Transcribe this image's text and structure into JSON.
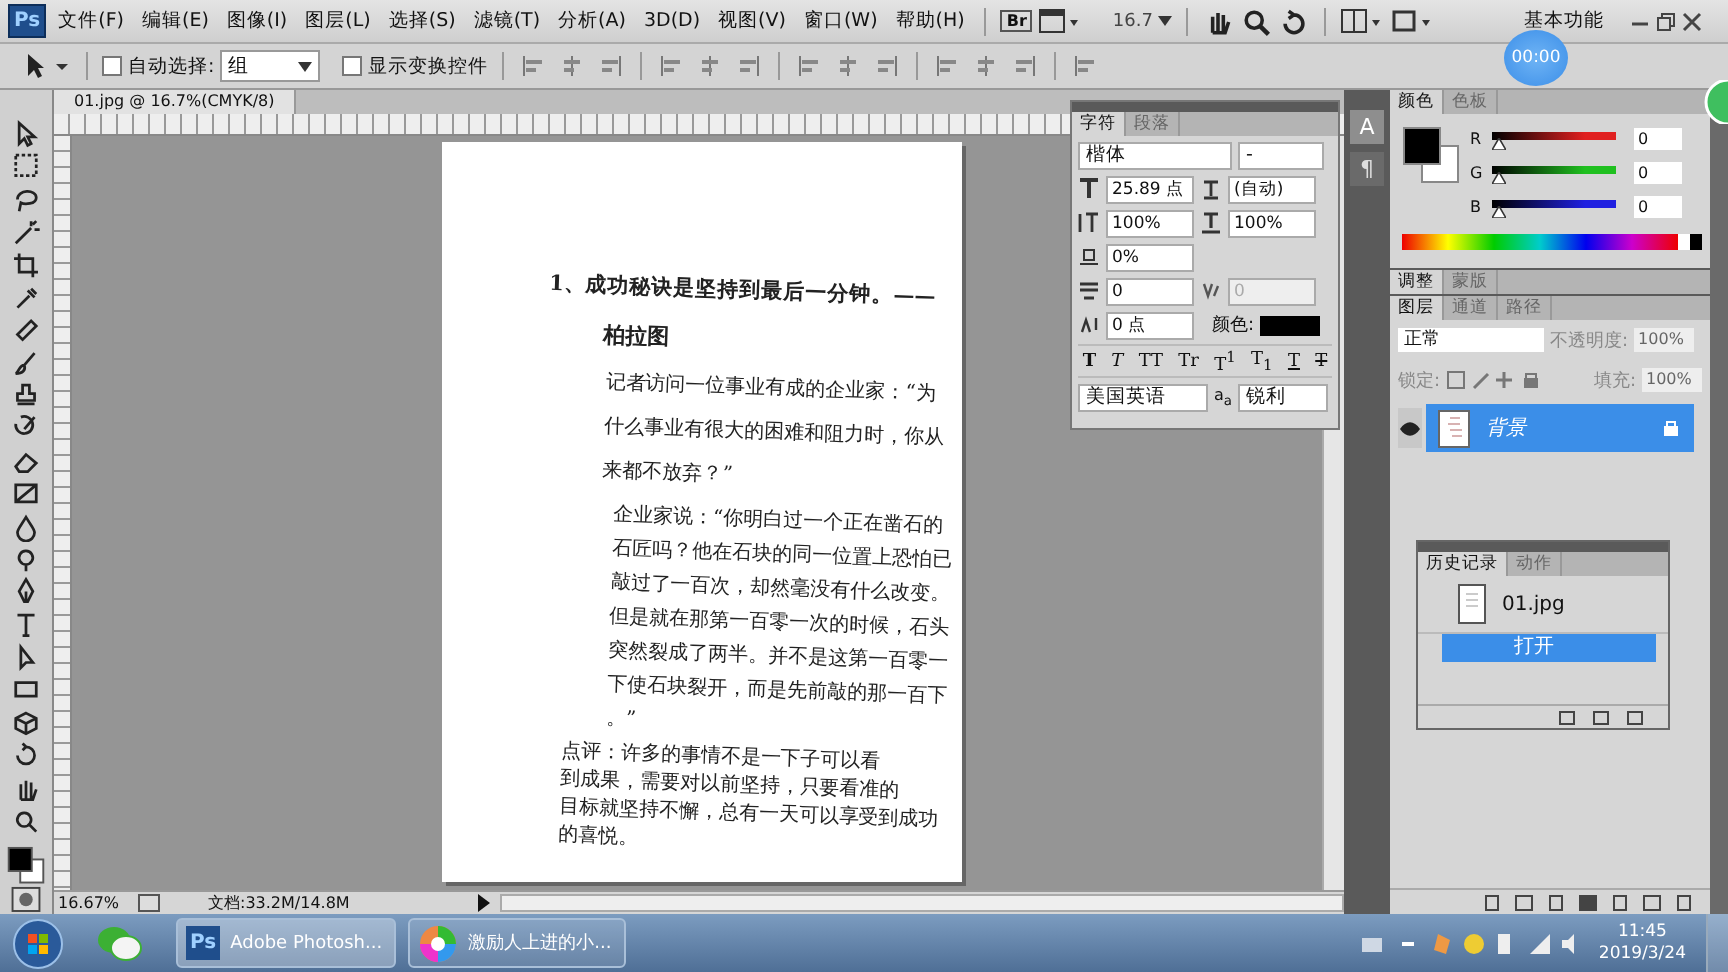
{
  "menubar": {
    "logo": "Ps",
    "items": [
      "文件(F)",
      "编辑(E)",
      "图像(I)",
      "图层(L)",
      "选择(S)",
      "滤镜(T)",
      "分析(A)",
      "3D(D)",
      "视图(V)",
      "窗口(W)",
      "帮助(H)"
    ],
    "bridge": "Br",
    "zoom": "16.7",
    "workspace": "基本功能"
  },
  "timer_badge": "00:00",
  "options_bar": {
    "auto_select": {
      "label": "自动选择:",
      "checked": false,
      "value": "组"
    },
    "show_transform": {
      "label": "显示变换控件",
      "checked": false
    }
  },
  "document": {
    "tab": "01.jpg @ 16.7%(CMYK/8)",
    "lines": [
      {
        "text": "1、成功秘诀是坚持到最后一分钟。——",
        "kind": "heading"
      },
      {
        "text": "柏拉图",
        "kind": "author"
      },
      {
        "text": "记者访问一位事业有成的企业家：“为",
        "kind": "body"
      },
      {
        "text": "什么事业有很大的困难和阻力时，你从",
        "kind": "body"
      },
      {
        "text": "来都不放弃？”",
        "kind": "body"
      },
      {
        "text": "企业家说：“你明白过一个正在凿石的",
        "kind": "quote"
      },
      {
        "text": "石匠吗？他在石块的同一位置上恐怕已",
        "kind": "quote"
      },
      {
        "text": "敲过了一百次，却然毫没有什么改变。",
        "kind": "quote"
      },
      {
        "text": "但是就在那第一百零一次的时候，石头",
        "kind": "quote"
      },
      {
        "text": "突然裂成了两半。并不是这第一百零一",
        "kind": "quote"
      },
      {
        "text": "下使石块裂开，而是先前敲的那一百下",
        "kind": "quote"
      },
      {
        "text": "。”",
        "kind": "quote"
      },
      {
        "text": "点评：许多的事情不是一下子可以看",
        "kind": "note"
      },
      {
        "text": "到成果，需要对以前坚持，只要看准的",
        "kind": "note"
      },
      {
        "text": "目标就坚持不懈，总有一天可以享受到成功",
        "kind": "note"
      },
      {
        "text": "的喜悦。",
        "kind": "note"
      }
    ]
  },
  "status_bar": {
    "zoom": "16.67%",
    "doc_info": "文档:33.2M/14.8M"
  },
  "dock_buttons": [
    {
      "label": "A",
      "selected": true
    },
    {
      "label": "¶",
      "selected": false
    }
  ],
  "character_panel": {
    "tabs": [
      {
        "label": "字符",
        "selected": true
      },
      {
        "label": "段落",
        "selected": false
      }
    ],
    "font": "楷体",
    "font_style": "-",
    "size": "25.89 点",
    "leading": "(自动)",
    "vertical_scale": "100%",
    "horizontal_scale": "100%",
    "tsume": "0%",
    "kerning": "0",
    "tracking": "0",
    "baseline": "0 点",
    "color_label": "颜色:",
    "style_buttons": [
      {
        "text": "T",
        "kind": "bold"
      },
      {
        "text": "T",
        "kind": "italic"
      },
      {
        "text": "TT",
        "kind": "caps"
      },
      {
        "text": "Tr",
        "kind": "smallcaps"
      },
      {
        "text": "T$^{1}$",
        "kind": "plain"
      },
      {
        "text": "T$_{1}$",
        "kind": "plain"
      },
      {
        "text": "T",
        "kind": "underline"
      },
      {
        "text": "T",
        "kind": "strike"
      }
    ],
    "language": "美国英语",
    "aa_label": "a$_{a}$",
    "antialias": "锐利"
  },
  "color_panel": {
    "tabs": [
      {
        "label": "颜色",
        "selected": true
      },
      {
        "label": "色板",
        "selected": false
      }
    ],
    "channels": [
      {
        "label": "R",
        "value": "0",
        "level": 0,
        "color": "#e02020"
      },
      {
        "label": "G",
        "value": "0",
        "level": 0,
        "color": "#20c020"
      },
      {
        "label": "B",
        "value": "0",
        "level": 0,
        "color": "#2020e0"
      }
    ]
  },
  "adjust_panel": {
    "tabs": [
      {
        "label": "调整",
        "selected": true
      },
      {
        "label": "蒙版",
        "selected": false
      }
    ]
  },
  "layers_panel": {
    "tabs": [
      {
        "label": "图层",
        "selected": true
      },
      {
        "label": "通道",
        "selected": false
      },
      {
        "label": "路径",
        "selected": false
      }
    ],
    "blend_mode": "正常",
    "opacity_label": "不透明度:",
    "opacity": "100%",
    "lock_label": "锁定:",
    "fill_label": "填充:",
    "fill": "100%",
    "layers": [
      {
        "name": "背景",
        "selected": true,
        "visible": true,
        "locked": true
      }
    ]
  },
  "history_panel": {
    "tabs": [
      {
        "label": "历史记录",
        "selected": true
      },
      {
        "label": "动作",
        "selected": false
      }
    ],
    "snapshot": "01.jpg",
    "items": [
      {
        "name": "打开",
        "selected": true
      }
    ]
  },
  "taskbar": {
    "apps": [
      {
        "label": "Adobe Photosh...",
        "logo": "Ps",
        "kind": "photoshop",
        "selected": true
      },
      {
        "label": "激励人上进的小...",
        "kind": "pinwheel",
        "selected": false
      }
    ],
    "time": "11:45",
    "date": "2019/3/24"
  }
}
